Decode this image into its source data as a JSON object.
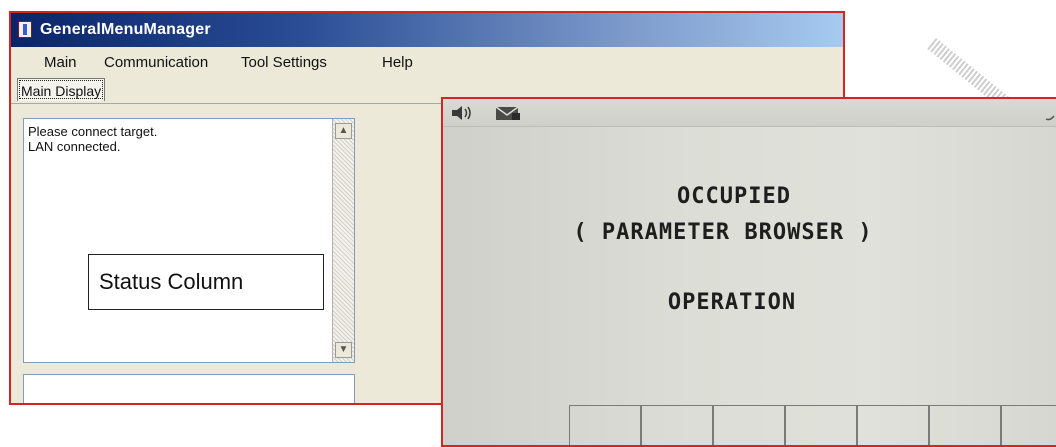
{
  "window": {
    "title": "GeneralMenuManager",
    "menu": [
      "Main",
      "Communication",
      "Tool Settings",
      "Help"
    ],
    "tab_label": "Main Display",
    "status_lines": [
      "Please connect target.",
      "LAN connected."
    ],
    "annotation_label": "Status Column"
  },
  "pendant": {
    "lines": [
      "OCCUPIED",
      "( PARAMETER BROWSER )",
      "OPERATION"
    ],
    "icons": [
      "speaker-icon",
      "mail-icon",
      "corner-icon"
    ]
  },
  "colors": {
    "highlight_border": "#d82323",
    "titlebar_start": "#0a246a",
    "titlebar_end": "#a6caf0",
    "window_bg": "#ece9d8",
    "pendant_bg": "#dcddd6"
  }
}
